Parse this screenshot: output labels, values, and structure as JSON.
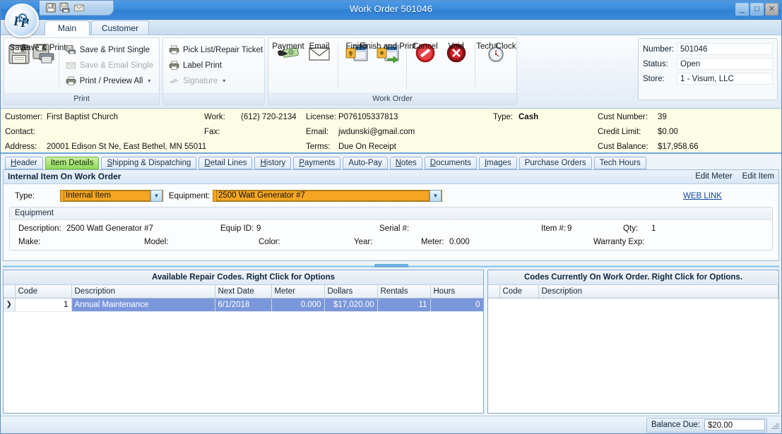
{
  "window": {
    "title": "Work Order 501046",
    "minimize": "_",
    "maximize": "□",
    "close": "✕",
    "quick_access": [
      "save-icon",
      "save-print-icon",
      "email-icon"
    ]
  },
  "ribbon_tabs": [
    {
      "label": "Main",
      "active": true
    },
    {
      "label": "Customer",
      "active": false
    }
  ],
  "ribbon": {
    "groups": [
      {
        "caption": "Print",
        "big_buttons": [
          {
            "label": "Save",
            "icon": "floppy-disk-icon"
          },
          {
            "label": "Save & Print",
            "icon": "floppy-printer-icon"
          }
        ],
        "small_buttons": [
          {
            "label": "Save & Print Single",
            "icon": "save-print-small-icon",
            "disabled": false,
            "caret": false
          },
          {
            "label": "Save & Email Single",
            "icon": "envelope-small-icon",
            "disabled": true,
            "caret": false
          },
          {
            "label": "Print / Preview All",
            "icon": "printer-small-icon",
            "disabled": false,
            "caret": true
          }
        ]
      },
      {
        "caption": "",
        "small_buttons": [
          {
            "label": "Pick List/Repair Ticket",
            "icon": "printer-small-icon",
            "disabled": false,
            "caret": true
          },
          {
            "label": "Label Print",
            "icon": "printer-small-icon",
            "disabled": false,
            "caret": false
          },
          {
            "label": "Signature",
            "icon": "signature-pen-icon",
            "disabled": true,
            "caret": true
          }
        ]
      },
      {
        "caption": "Work Order",
        "big_buttons": [
          {
            "label": "Payment",
            "icon": "money-hand-icon"
          },
          {
            "label": "Email",
            "icon": "envelope-icon"
          },
          {
            "label": "Finish",
            "icon": "finish-register-icon"
          },
          {
            "label": "Finish and Print",
            "icon": "finish-print-icon"
          },
          {
            "label": "Cancel",
            "icon": "cancel-circle-icon"
          },
          {
            "label": "Void",
            "icon": "void-circle-icon"
          },
          {
            "label": "Tech Clock",
            "icon": "stopwatch-icon"
          }
        ]
      }
    ]
  },
  "info": {
    "number_label": "Number:",
    "number_value": "501046",
    "status_label": "Status:",
    "status_value": "Open",
    "store_label": "Store:",
    "store_value": "1 - Visum, LLC"
  },
  "banner": {
    "customer_label": "Customer:",
    "customer_value": "First Baptist Church",
    "contact_label": "Contact:",
    "contact_value": "",
    "address_label": "Address:",
    "address_value": "20001 Edison St Ne, East Bethel, MN 55011",
    "work_label": "Work:",
    "work_value": "(612) 720-2134",
    "fax_label": "Fax:",
    "fax_value": "",
    "license_label": "License:",
    "license_value": "P076105337813",
    "email_label": "Email:",
    "email_value": "jwdunski@gmail.com",
    "terms_label": "Terms:",
    "terms_value": "Due On Receipt",
    "type_label": "Type:",
    "type_value": "Cash",
    "cust_number_label": "Cust Number:",
    "cust_number_value": "39",
    "credit_limit_label": "Credit Limit:",
    "credit_limit_value": "$0.00",
    "cust_balance_label": "Cust Balance:",
    "cust_balance_value": "$17,958.66"
  },
  "detail_tabs": [
    {
      "label": "Header",
      "mnemonic": "H",
      "active": false
    },
    {
      "label": "Item Details",
      "mnemonic": "I",
      "active": true
    },
    {
      "label": "Shipping & Dispatching",
      "mnemonic": "S",
      "active": false
    },
    {
      "label": "Detail Lines",
      "mnemonic": "D",
      "active": false
    },
    {
      "label": "History",
      "mnemonic": "H",
      "active": false
    },
    {
      "label": "Payments",
      "mnemonic": "P",
      "active": false
    },
    {
      "label": "Auto-Pay",
      "mnemonic": "",
      "active": false
    },
    {
      "label": "Notes",
      "mnemonic": "N",
      "active": false
    },
    {
      "label": "Documents",
      "mnemonic": "D",
      "active": false
    },
    {
      "label": "Images",
      "mnemonic": "I",
      "active": false
    },
    {
      "label": "Purchase Orders",
      "mnemonic": "",
      "active": false
    },
    {
      "label": "Tech Hours",
      "mnemonic": "",
      "active": false
    }
  ],
  "item_panel": {
    "title": "Internal Item On Work Order",
    "edit_meter_label": "Edit Meter",
    "edit_item_label": "Edit Item",
    "type_label": "Type:",
    "type_value": "Internal Item",
    "equipment_label": "Equipment:",
    "equipment_value": "2500 Watt Generator #7",
    "web_link_label": "WEB LINK",
    "equipment_group_title": "Equipment",
    "fields": {
      "description_label": "Description:",
      "description_value": "2500 Watt Generator #7",
      "equip_id_label": "Equip ID:",
      "equip_id_value": "9",
      "serial_label": "Serial #:",
      "serial_value": "",
      "item_num_label": "Item #:",
      "item_num_value": "9",
      "qty_label": "Qty:",
      "qty_value": "1",
      "make_label": "Make:",
      "make_value": "",
      "model_label": "Model:",
      "model_value": "",
      "color_label": "Color:",
      "color_value": "",
      "year_label": "Year:",
      "year_value": "",
      "meter_label": "Meter:",
      "meter_value": "0.000",
      "warranty_label": "Warranty Exp:",
      "warranty_value": ""
    }
  },
  "available_grid": {
    "title": "Available Repair Codes. Right Click for Options",
    "columns": [
      "Code",
      "Description",
      "Next Date",
      "Meter",
      "Dollars",
      "Rentals",
      "Hours"
    ],
    "rows": [
      {
        "indicator": "❯",
        "code": "1",
        "description": "Annual Maintenance",
        "next_date": "6/1/2018",
        "meter": "0.000",
        "dollars": "$17,020.00",
        "rentals": "11",
        "hours": "0",
        "selected": true
      }
    ]
  },
  "current_grid": {
    "title": "Codes Currently On Work Order. Right Click for Options.",
    "columns": [
      "Code",
      "Description"
    ],
    "rows": []
  },
  "status_bar": {
    "balance_label": "Balance Due:",
    "balance_value": "$20.00"
  },
  "colors": {
    "title_blue": "#3c8cdc",
    "active_tab_green": "#8fd95c",
    "highlight_orange": "#f5a623",
    "row_selection_blue": "#7b97db",
    "banner_cream": "#fdfde6",
    "link_blue": "#1144aa"
  }
}
